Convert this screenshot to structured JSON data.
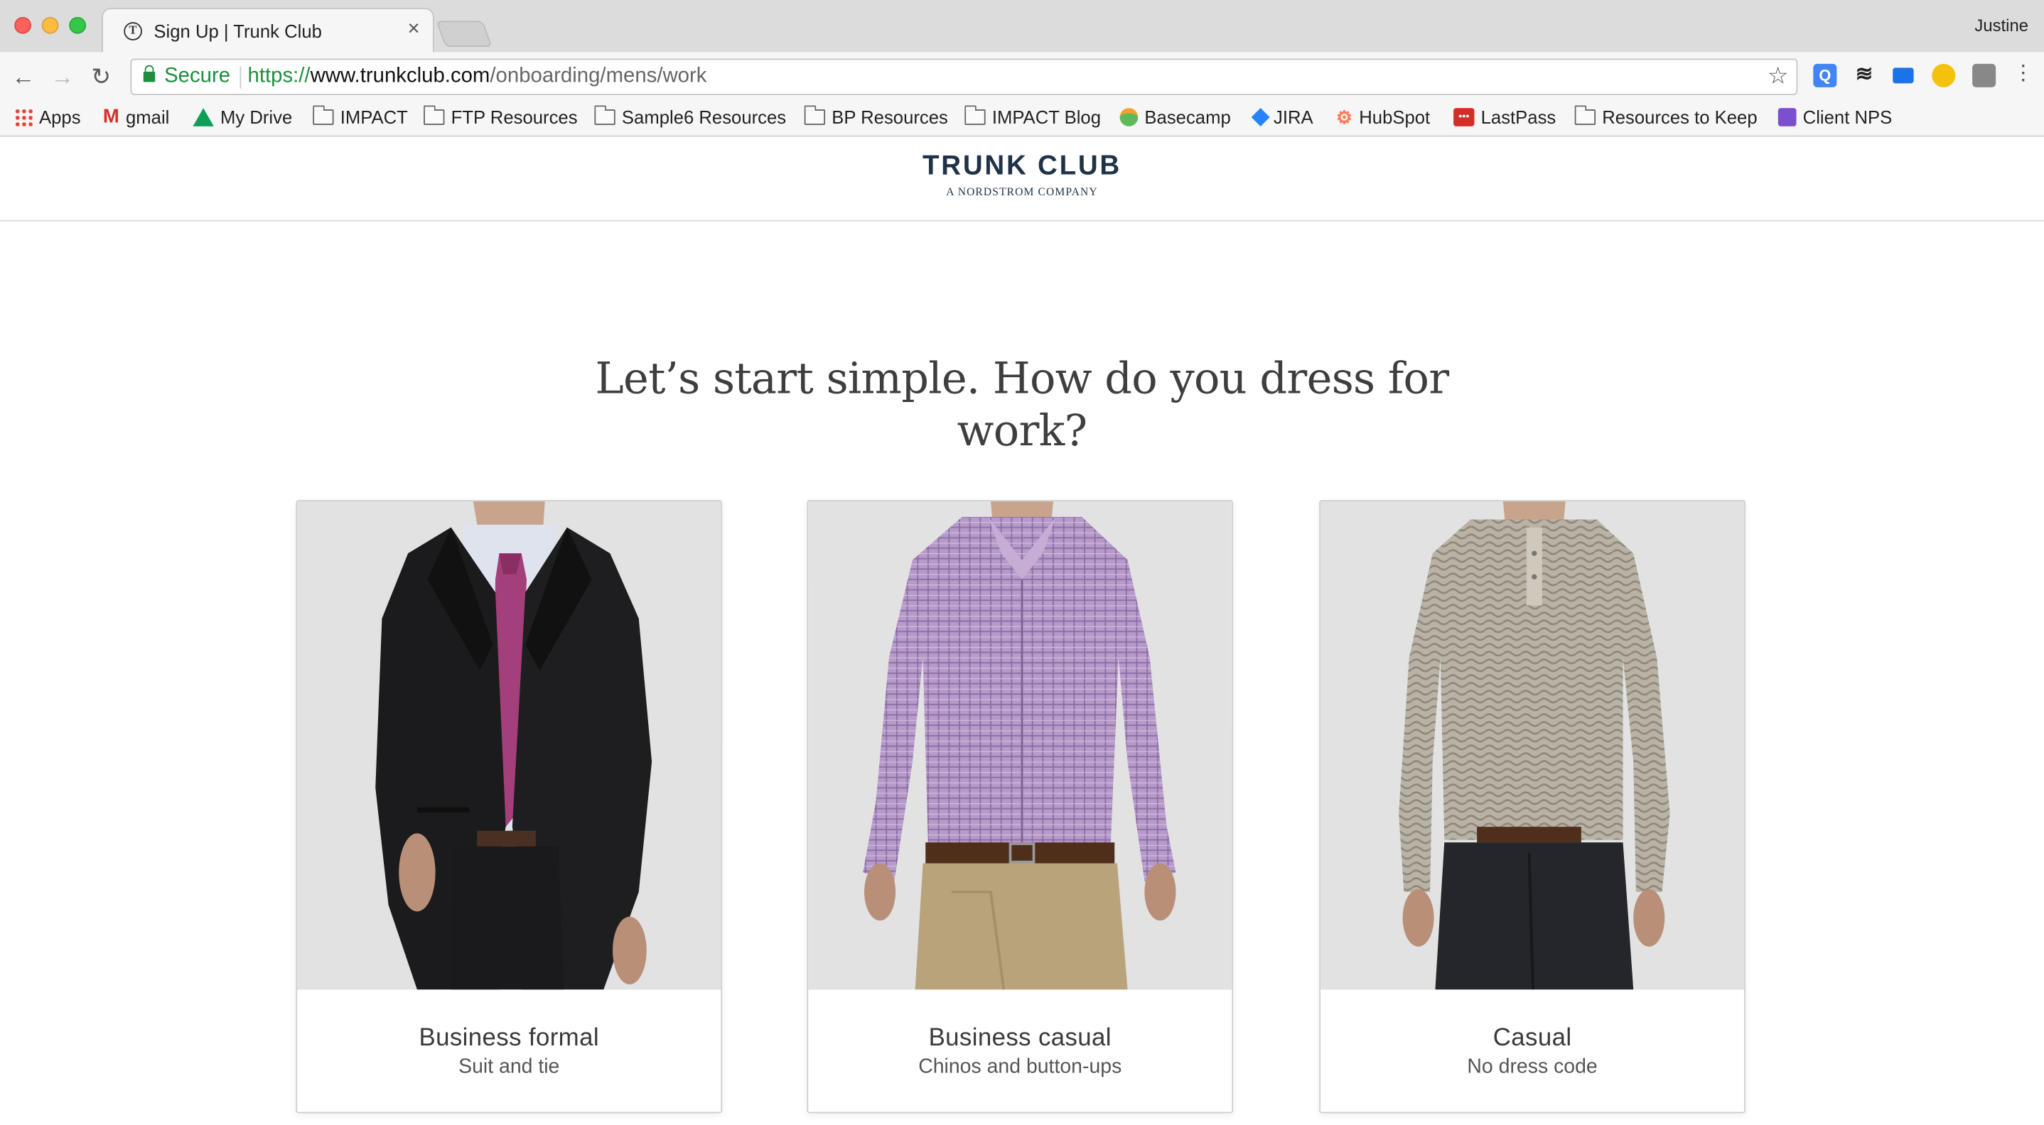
{
  "browser": {
    "tab_title": "Sign Up | Trunk Club",
    "profile_name": "Justine",
    "secure_label": "Secure",
    "url_scheme": "https://",
    "url_host": "www.trunkclub.com",
    "url_path": "/onboarding/mens/work",
    "bookmarks": [
      "Apps",
      "gmail",
      "My Drive",
      "IMPACT",
      "FTP Resources",
      "Sample6 Resources",
      "BP Resources",
      "IMPACT Blog",
      "Basecamp",
      "JIRA",
      "HubSpot",
      "LastPass",
      "Resources to Keep",
      "Client NPS"
    ]
  },
  "site": {
    "brand_name": "TRUNK CLUB",
    "brand_sub": "A NORDSTROM COMPANY",
    "headline": "Let’s start simple. How do you dress for work?",
    "options": [
      {
        "title": "Business formal",
        "subtitle": "Suit and tie"
      },
      {
        "title": "Business casual",
        "subtitle": "Chinos and button-ups"
      },
      {
        "title": "Casual",
        "subtitle": "No dress code"
      }
    ]
  },
  "colors": {
    "brand": "#1f3247",
    "secure_green": "#1e8e3e",
    "headline": "#3e3e3e"
  }
}
